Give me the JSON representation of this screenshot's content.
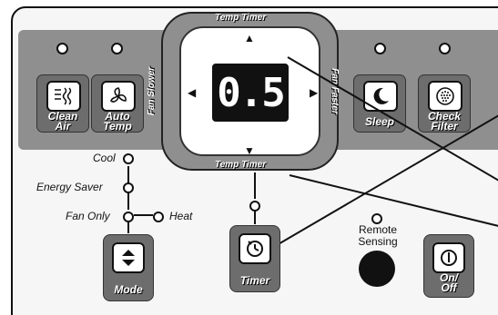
{
  "display": {
    "value": "0.5"
  },
  "ring": {
    "top_label": "Temp Timer",
    "bottom_label": "Temp Timer",
    "left_label": "Fan Slower",
    "right_label": "Fan Faster"
  },
  "buttons": {
    "clean_air": {
      "line1": "Clean",
      "line2": "Air",
      "icon": "clean-air-icon"
    },
    "auto_temp": {
      "line1": "Auto",
      "line2": "Temp",
      "icon": "fan-icon"
    },
    "sleep": {
      "line1": "Sleep",
      "icon": "moon-icon"
    },
    "check_filter": {
      "line1": "Check",
      "line2": "Filter",
      "icon": "filter-icon"
    },
    "mode": {
      "label": "Mode",
      "icon": "up-down-icon"
    },
    "timer": {
      "label": "Timer",
      "icon": "timer-icon"
    },
    "onoff": {
      "line1": "On/",
      "line2": "Off",
      "icon": "power-icon"
    }
  },
  "modes": {
    "cool": "Cool",
    "energy_saver": "Energy Saver",
    "fan_only": "Fan Only",
    "heat": "Heat"
  },
  "remote_sensing": {
    "line1": "Remote",
    "line2": "Sensing"
  },
  "colors": {
    "panel": "#8f8f8f",
    "button": "#6d6d6d",
    "display": "#111111"
  }
}
